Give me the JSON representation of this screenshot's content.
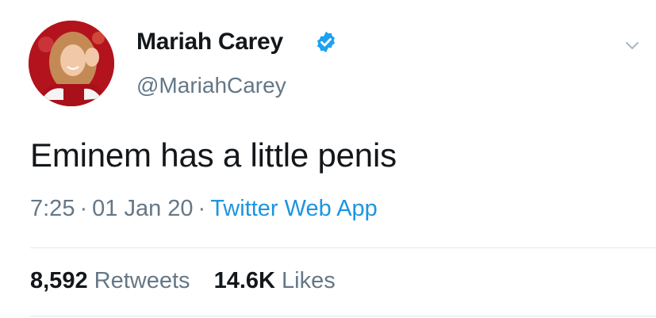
{
  "tweet": {
    "display_name": "Mariah Carey",
    "handle": "@MariahCarey",
    "text": "Eminem has a little penis",
    "time": "7:25",
    "date": "01 Jan 20",
    "source": "Twitter Web App",
    "separator": "·",
    "stats": {
      "retweets_count": "8,592",
      "retweets_label": "Retweets",
      "likes_count": "14.6K",
      "likes_label": "Likes"
    }
  },
  "icons": {
    "verified": "verified-badge-icon",
    "menu": "chevron-down-icon",
    "avatar": "profile-photo"
  },
  "colors": {
    "name": "#14171a",
    "secondary": "#657786",
    "link": "#1b95e0",
    "verified": "#1da1f2",
    "divider": "#e1e8ed"
  }
}
